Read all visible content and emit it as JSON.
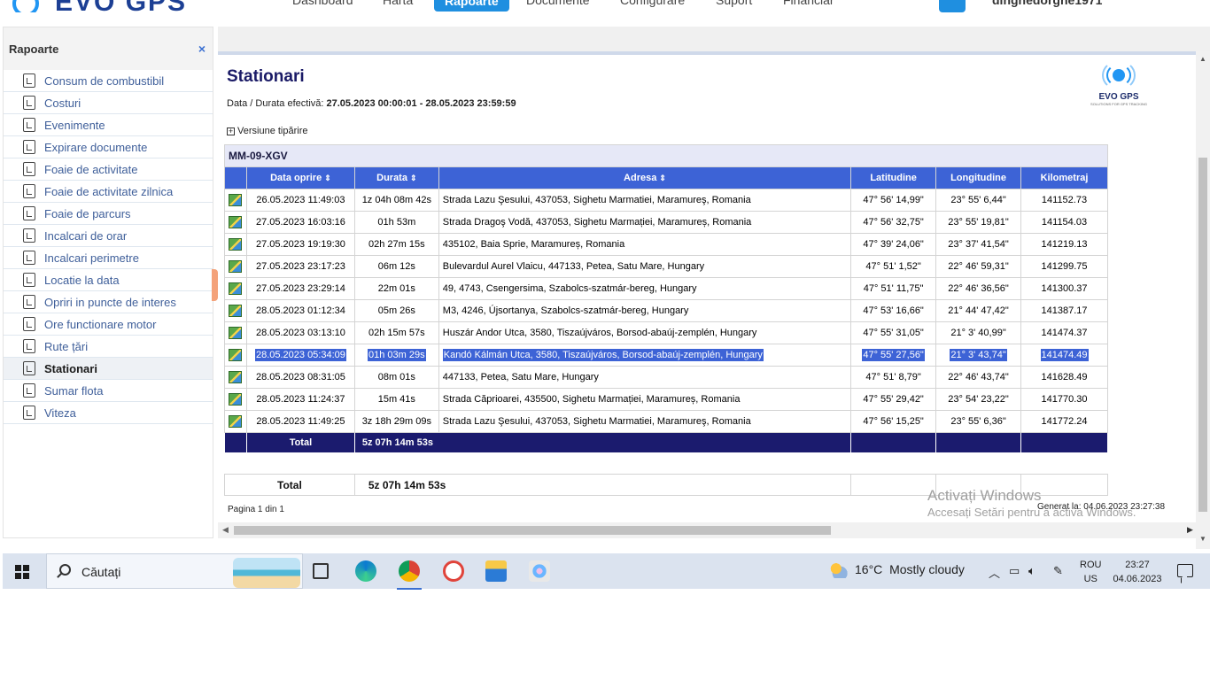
{
  "topnav": {
    "brand": "EVO GPS",
    "items": [
      "Dashboard",
      "Harta",
      "Rapoarte",
      "Documente",
      "Configurare",
      "Suport",
      "Financiar"
    ],
    "active": "Rapoarte",
    "user": "dinghedorghe1971"
  },
  "sidebar": {
    "title": "Rapoarte",
    "close": "×",
    "items": [
      "Consum de combustibil",
      "Costuri",
      "Evenimente",
      "Expirare documente",
      "Foaie de activitate",
      "Foaie de activitate zilnica",
      "Foaie de parcurs",
      "Incalcari de orar",
      "Incalcari perimetre",
      "Locatie la data",
      "Opriri in puncte de interes",
      "Ore functionare motor",
      "Rute țări",
      "Stationari",
      "Sumar flota",
      "Viteza"
    ],
    "active_index": 13
  },
  "report": {
    "title": "Stationari",
    "period_label": "Data / Durata efectivă:",
    "period_value": "27.05.2023 00:00:01 - 28.05.2023 23:59:59",
    "print_version": "Versiune tipărire",
    "logo_text": "EVO GPS",
    "logo_tagline": "SOLUTIONS FOR GPS TRACKING",
    "vehicle": "MM-09-XGV",
    "columns": [
      "Data oprire",
      "Durata",
      "Adresa",
      "Latitudine",
      "Longitudine",
      "Kilometraj"
    ],
    "sort_glyph": "⇕",
    "rows": [
      {
        "date": "26.05.2023 11:49:03",
        "duration": "1z 04h 08m 42s",
        "address": "Strada Lazu Şesului,  437053, Sighetu Marmatiei, Maramureş, Romania",
        "lat": "47° 56' 14,99\"",
        "lon": "23° 55' 6,44\"",
        "km": "141152.73"
      },
      {
        "date": "27.05.2023 16:03:16",
        "duration": "01h 53m",
        "address": "Strada Dragoş Vodă,  437053, Sighetu Marmației, Maramureș, Romania",
        "lat": "47° 56' 32,75\"",
        "lon": "23° 55' 19,81\"",
        "km": "141154.03"
      },
      {
        "date": "27.05.2023 19:19:30",
        "duration": "02h 27m 15s",
        "address": "435102, Baia Sprie, Maramureș, Romania",
        "lat": "47° 39' 24,06\"",
        "lon": "23° 37' 41,54\"",
        "km": "141219.13"
      },
      {
        "date": "27.05.2023 23:17:23",
        "duration": "06m 12s",
        "address": "Bulevardul Aurel Vlaicu,  447133, Petea, Satu Mare, Hungary",
        "lat": "47° 51' 1,52\"",
        "lon": "22° 46' 59,31\"",
        "km": "141299.75"
      },
      {
        "date": "27.05.2023 23:29:14",
        "duration": "22m 01s",
        "address": "49,  4743, Csengersima, Szabolcs-szatmár-bereg, Hungary",
        "lat": "47° 51' 11,75\"",
        "lon": "22° 46' 36,56\"",
        "km": "141300.37"
      },
      {
        "date": "28.05.2023 01:12:34",
        "duration": "05m 26s",
        "address": "M3,  4246, Újsortanya, Szabolcs-szatmár-bereg, Hungary",
        "lat": "47° 53' 16,66\"",
        "lon": "21° 44' 47,42\"",
        "km": "141387.17"
      },
      {
        "date": "28.05.2023 03:13:10",
        "duration": "02h 15m 57s",
        "address": "Huszár Andor Utca,  3580, Tiszaújváros, Borsod-abaúj-zemplén, Hungary",
        "lat": "47° 55' 31,05\"",
        "lon": "21° 3' 40,99\"",
        "km": "141474.37"
      },
      {
        "date": "28.05.2023 05:34:09",
        "duration": "01h 03m 29s",
        "address": "Kandó Kálmán Utca,  3580, Tiszaújváros, Borsod-abaúj-zemplén, Hungary",
        "lat": "47° 55' 27,56\"",
        "lon": "21° 3' 43,74\"",
        "km": "141474.49",
        "selected": true
      },
      {
        "date": "28.05.2023 08:31:05",
        "duration": "08m 01s",
        "address": "447133, Petea, Satu Mare, Hungary",
        "lat": "47° 51' 8,79\"",
        "lon": "22° 46' 43,74\"",
        "km": "141628.49"
      },
      {
        "date": "28.05.2023 11:24:37",
        "duration": "15m 41s",
        "address": "Strada Căprioarei,  435500, Sighetu Marmației, Maramureș, Romania",
        "lat": "47° 55' 29,42\"",
        "lon": "23° 54' 23,22\"",
        "km": "141770.30"
      },
      {
        "date": "28.05.2023 11:49:25",
        "duration": "3z 18h 29m 09s",
        "address": "Strada Lazu Şesului,  437053, Sighetu Marmatiei, Maramureş, Romania",
        "lat": "47° 56' 15,25\"",
        "lon": "23° 55' 6,36\"",
        "km": "141772.24"
      }
    ],
    "total_label": "Total",
    "total_value": "5z 07h 14m 53s",
    "grand_total_label": "Total",
    "grand_total_value": "5z 07h 14m 53s",
    "page": "Pagina 1 din 1",
    "generated": "Generat la: 04.06.2023 23:27:38"
  },
  "watermark": {
    "line1": "Activați Windows",
    "line2": "Accesați Setări pentru a activa Windows."
  },
  "taskbar": {
    "search_placeholder": "Căutați",
    "temperature": "16°C",
    "weather": "Mostly cloudy",
    "lang1": "ROU",
    "lang2": "US",
    "time": "23:27",
    "date": "04.06.2023"
  },
  "colors": {
    "header_blue": "#3d63d6",
    "total_navy": "#1b1b6e",
    "title_navy": "#1a1a66",
    "vehicle_row": "#e6e8f7",
    "accent_orange": "#f4a27a"
  }
}
